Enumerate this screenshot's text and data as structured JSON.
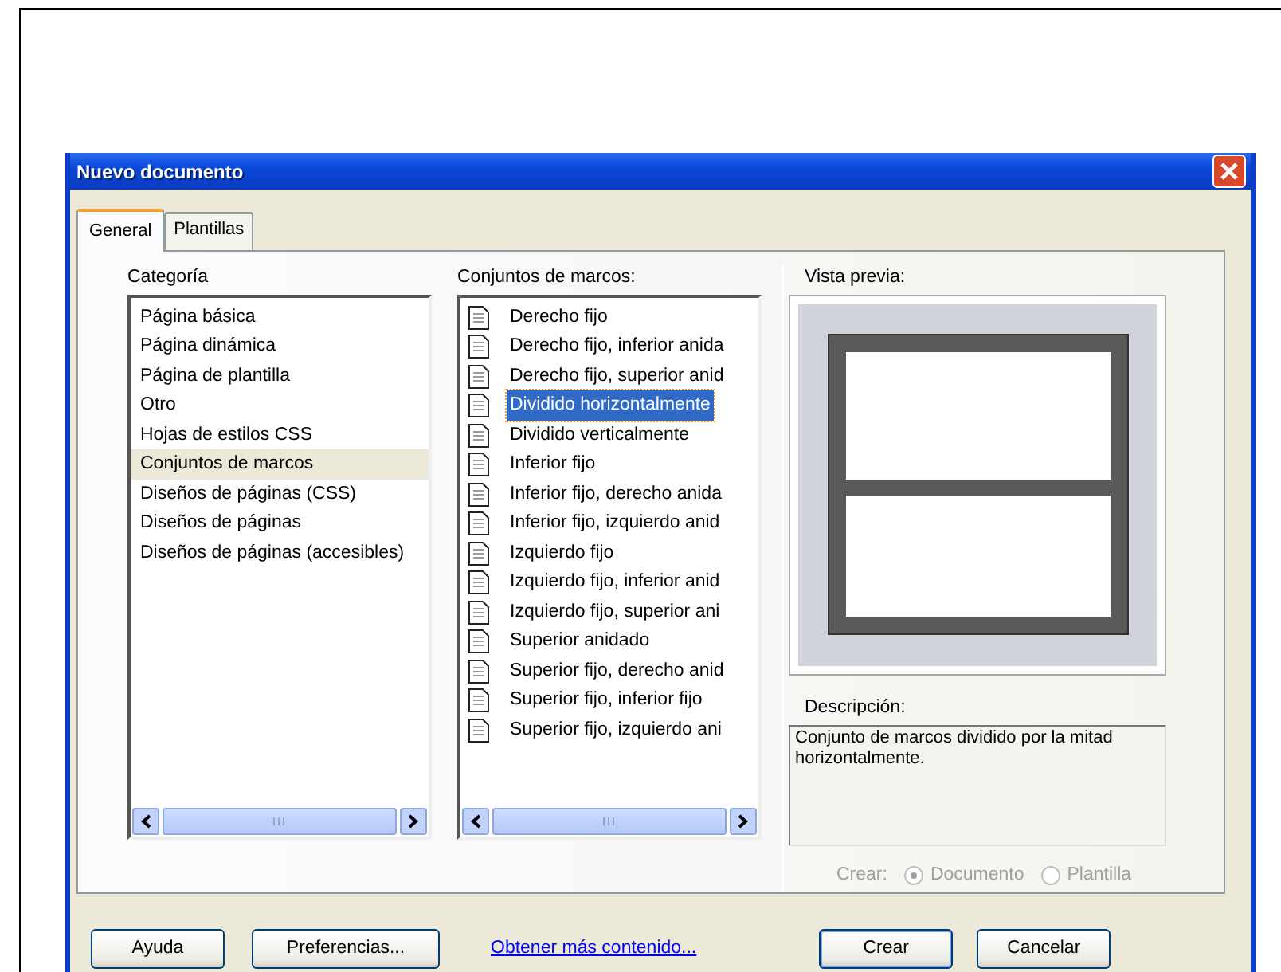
{
  "window": {
    "title": "Nuevo documento"
  },
  "tabs": [
    {
      "label": "General",
      "selected": true
    },
    {
      "label": "Plantillas",
      "selected": false
    }
  ],
  "category": {
    "label": "Categoría",
    "items": [
      {
        "label": "Página básica",
        "selected": false
      },
      {
        "label": "Página dinámica",
        "selected": false
      },
      {
        "label": "Página de plantilla",
        "selected": false
      },
      {
        "label": "Otro",
        "selected": false
      },
      {
        "label": "Hojas de estilos CSS",
        "selected": false
      },
      {
        "label": "Conjuntos de marcos",
        "selected": true
      },
      {
        "label": "Diseños de páginas (CSS)",
        "selected": false
      },
      {
        "label": "Diseños de páginas",
        "selected": false
      },
      {
        "label": "Diseños de páginas (accesibles)",
        "selected": false
      }
    ]
  },
  "framesets": {
    "label": "Conjuntos de marcos:",
    "items": [
      {
        "label": "Derecho fijo",
        "selected": false
      },
      {
        "label": "Derecho fijo, inferior anida",
        "selected": false
      },
      {
        "label": "Derecho fijo, superior anid",
        "selected": false
      },
      {
        "label": "Dividido horizontalmente",
        "selected": true
      },
      {
        "label": "Dividido verticalmente",
        "selected": false
      },
      {
        "label": "Inferior fijo",
        "selected": false
      },
      {
        "label": "Inferior fijo, derecho anida",
        "selected": false
      },
      {
        "label": "Inferior fijo, izquierdo anid",
        "selected": false
      },
      {
        "label": "Izquierdo fijo",
        "selected": false
      },
      {
        "label": "Izquierdo fijo, inferior anid",
        "selected": false
      },
      {
        "label": "Izquierdo fijo, superior ani",
        "selected": false
      },
      {
        "label": "Superior anidado",
        "selected": false
      },
      {
        "label": "Superior fijo, derecho anid",
        "selected": false
      },
      {
        "label": "Superior fijo, inferior fijo",
        "selected": false
      },
      {
        "label": "Superior fijo, izquierdo ani",
        "selected": false
      }
    ]
  },
  "preview": {
    "label": "Vista previa:"
  },
  "description": {
    "label": "Descripción:",
    "text": "Conjunto de marcos dividido por la mitad horizontalmente."
  },
  "create_as": {
    "label": "Crear:",
    "disabled": true,
    "options": [
      {
        "label": "Documento",
        "selected": true
      },
      {
        "label": "Plantilla",
        "selected": false
      }
    ]
  },
  "buttons_left": [
    "Ayuda",
    "Preferencias..."
  ],
  "link": "Obtener más contenido...",
  "buttons_right": [
    {
      "label": "Crear",
      "default": true
    },
    {
      "label": "Cancelar",
      "default": false
    }
  ]
}
